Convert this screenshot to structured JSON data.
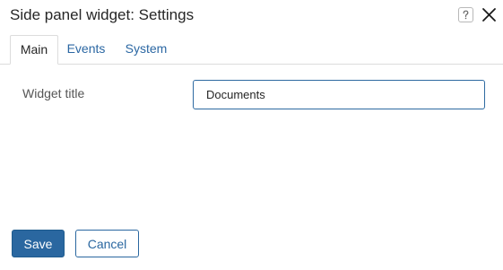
{
  "dialog": {
    "title": "Side panel widget: Settings"
  },
  "header_icons": {
    "help": "help-icon",
    "close": "close-icon"
  },
  "tabs": [
    {
      "label": "Main",
      "active": true
    },
    {
      "label": "Events",
      "active": false
    },
    {
      "label": "System",
      "active": false
    }
  ],
  "form": {
    "widget_title": {
      "label": "Widget title",
      "value": "Documents"
    }
  },
  "footer": {
    "save_label": "Save",
    "cancel_label": "Cancel"
  },
  "colors": {
    "accent": "#2a67a0",
    "tab_link": "#2b67a3",
    "border": "#dcdcdc"
  }
}
